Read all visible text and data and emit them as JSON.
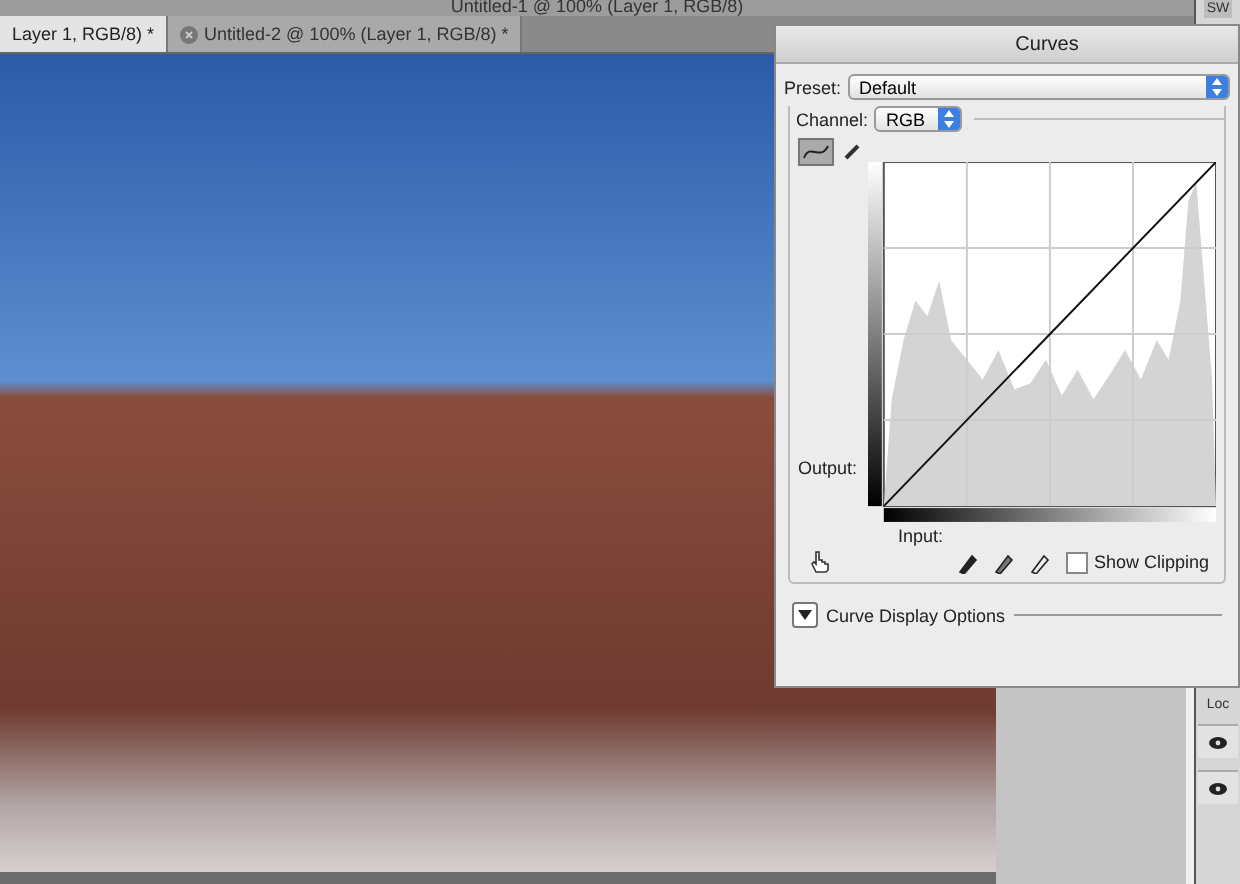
{
  "window": {
    "title": "Untitled-1 @ 100% (Layer 1, RGB/8)"
  },
  "tabs": [
    {
      "label": "Layer 1, RGB/8) *",
      "selected": true,
      "closable": false
    },
    {
      "label": "Untitled-2 @ 100% (Layer 1, RGB/8) *",
      "selected": false,
      "closable": true
    }
  ],
  "side_panel": {
    "tab": "SW",
    "label": "Loc",
    "layers": [
      {
        "visible": true
      },
      {
        "visible": true
      }
    ]
  },
  "curves": {
    "title": "Curves",
    "preset_label": "Preset:",
    "preset": "Default",
    "channel_label": "Channel:",
    "channel": "RGB",
    "tools": [
      {
        "kind": "curve",
        "selected": true
      },
      {
        "kind": "pencil",
        "selected": false
      }
    ],
    "output_label": "Output:",
    "input_label": "Input:",
    "eyedroppers": [
      {
        "kind": "black"
      },
      {
        "kind": "gray"
      },
      {
        "kind": "white"
      }
    ],
    "show_clipping": {
      "label": "Show Clipping",
      "checked": false
    },
    "display_options": {
      "label": "Curve Display Options",
      "expanded": false
    }
  }
}
